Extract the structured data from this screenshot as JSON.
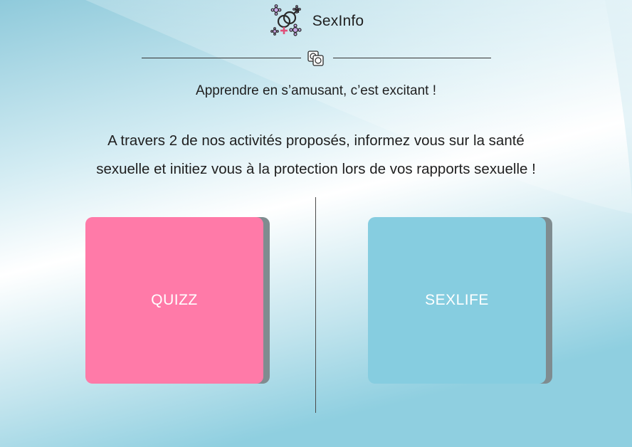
{
  "brand": {
    "name": "SexInfo",
    "logo_icon": "gender-symbols-icon"
  },
  "divider": {
    "icon": "condom-packets-icon"
  },
  "tagline": "Apprendre en s’amusant, c’est excitant !",
  "description": {
    "line1": "A travers 2 de nos activités proposés, informez vous sur la santé",
    "line2": "sexuelle et initiez vous à la protection lors de vos rapports sexuelle !"
  },
  "activities": {
    "quizz": {
      "label": "QUIZZ",
      "color": "#ff7aa8"
    },
    "sexlife": {
      "label": "SEXLIFE",
      "color": "#86cde0"
    }
  },
  "colors": {
    "background_light": "#ffffff",
    "background_blue": "#86cde0",
    "card_shadow": "#7f8c90"
  }
}
